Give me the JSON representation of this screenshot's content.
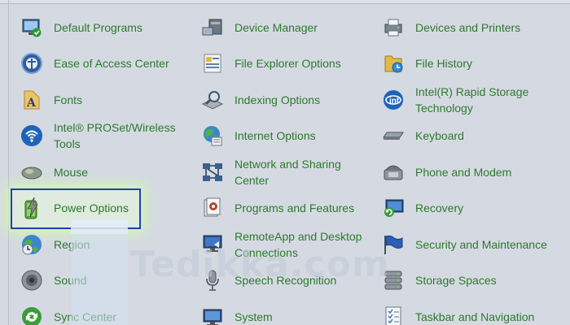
{
  "colors": {
    "link": "#2d7a2d",
    "background": "#d5dae2",
    "highlight_border": "#1f3fb8"
  },
  "columns": [
    {
      "items": [
        {
          "label": "Default Programs",
          "icon": "default-programs-icon"
        },
        {
          "label": "Ease of Access Center",
          "icon": "ease-of-access-icon"
        },
        {
          "label": "Fonts",
          "icon": "fonts-icon"
        },
        {
          "label": "Intel® PROSet/Wireless\nTools",
          "icon": "wireless-tools-icon"
        },
        {
          "label": "Mouse",
          "icon": "mouse-icon"
        },
        {
          "label": "Power Options",
          "icon": "power-options-icon"
        },
        {
          "label": "Region",
          "icon": "region-icon"
        },
        {
          "label": "Sound",
          "icon": "sound-icon"
        },
        {
          "label": "Sync Center",
          "icon": "sync-center-icon"
        }
      ]
    },
    {
      "items": [
        {
          "label": "Device Manager",
          "icon": "device-manager-icon"
        },
        {
          "label": "File Explorer Options",
          "icon": "file-explorer-options-icon"
        },
        {
          "label": "Indexing Options",
          "icon": "indexing-options-icon"
        },
        {
          "label": "Internet Options",
          "icon": "internet-options-icon"
        },
        {
          "label": "Network and Sharing\nCenter",
          "icon": "network-sharing-icon"
        },
        {
          "label": "Programs and Features",
          "icon": "programs-features-icon"
        },
        {
          "label": "RemoteApp and Desktop\nConnections",
          "icon": "remoteapp-icon"
        },
        {
          "label": "Speech Recognition",
          "icon": "microphone-icon"
        },
        {
          "label": "System",
          "icon": "system-icon"
        }
      ]
    },
    {
      "items": [
        {
          "label": "Devices and Printers",
          "icon": "devices-printers-icon"
        },
        {
          "label": "File History",
          "icon": "file-history-icon"
        },
        {
          "label": "Intel(R) Rapid Storage\nTechnology",
          "icon": "rapid-storage-icon"
        },
        {
          "label": "Keyboard",
          "icon": "keyboard-icon"
        },
        {
          "label": "Phone and Modem",
          "icon": "phone-modem-icon"
        },
        {
          "label": "Recovery",
          "icon": "recovery-icon"
        },
        {
          "label": "Security and Maintenance",
          "icon": "security-flag-icon"
        },
        {
          "label": "Storage Spaces",
          "icon": "storage-spaces-icon"
        },
        {
          "label": "Taskbar and Navigation",
          "icon": "taskbar-icon"
        }
      ]
    }
  ],
  "watermark": {
    "text": "Tedikka.com"
  }
}
